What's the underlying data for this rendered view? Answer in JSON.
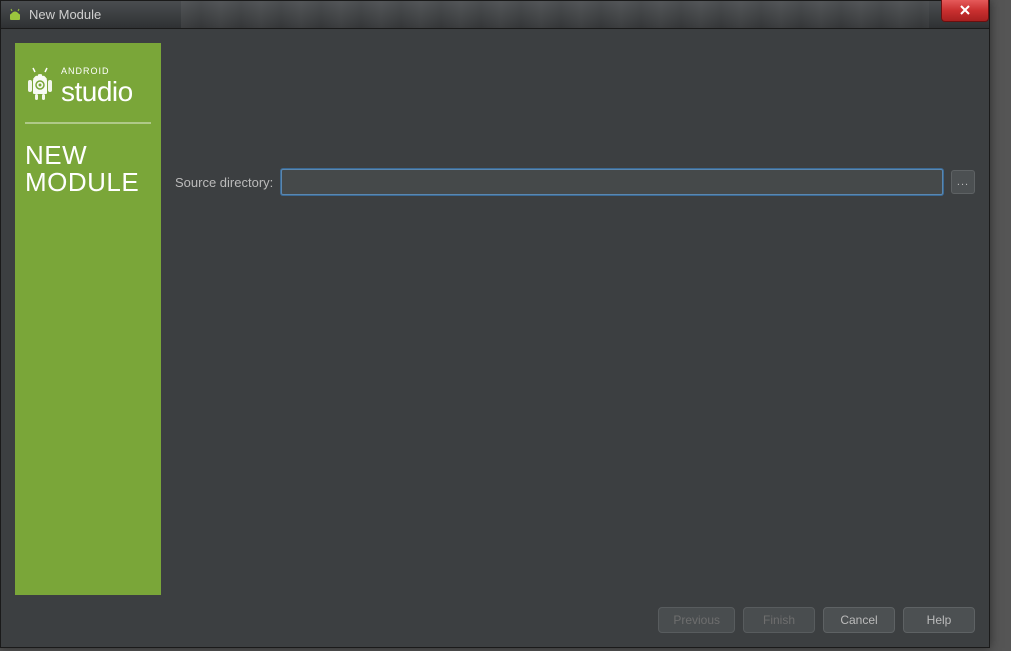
{
  "window": {
    "title": "New Module"
  },
  "sidebar": {
    "brand_small": "ANDROID",
    "brand_big": "studio",
    "heading_line1": "NEW",
    "heading_line2": "MODULE"
  },
  "form": {
    "source_directory_label": "Source directory:",
    "source_directory_value": "",
    "browse_label": "..."
  },
  "buttons": {
    "previous": "Previous",
    "finish": "Finish",
    "cancel": "Cancel",
    "help": "Help"
  },
  "colors": {
    "accent_green": "#7aa639",
    "panel_bg": "#3c3f41",
    "input_border_focus": "#5a87b0"
  }
}
